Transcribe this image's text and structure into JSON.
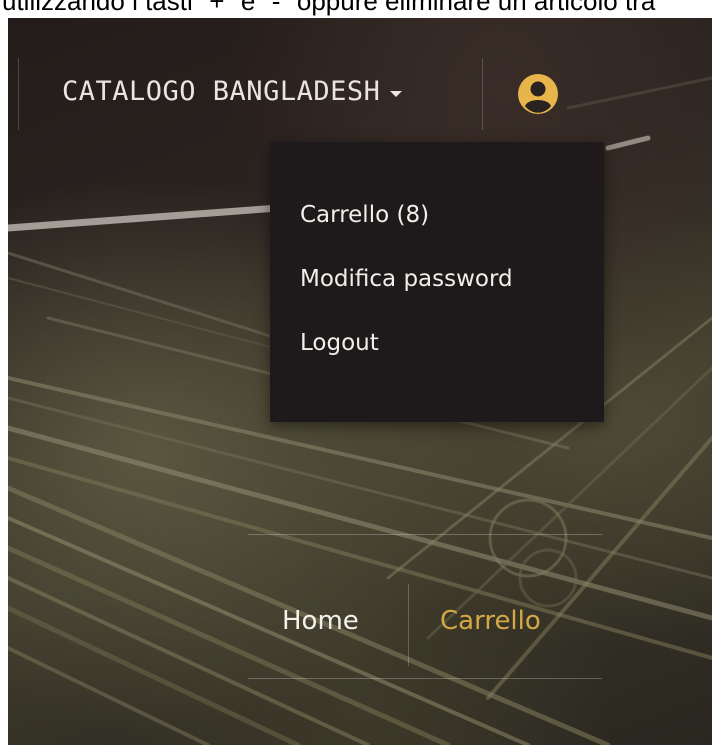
{
  "top_text": "utilizzando i tasti \"+\" e \"-\" oppure eliminare un articolo tra",
  "navbar": {
    "brand": "CATALOGO BANGLADESH",
    "user_icon": "user-circle-icon",
    "accent_color": "#e8b54a"
  },
  "dropdown": {
    "items": [
      {
        "label": "Carrello (8)"
      },
      {
        "label": "Modifica password"
      },
      {
        "label": "Logout"
      }
    ]
  },
  "page_nav": {
    "items": [
      {
        "label": "Home"
      },
      {
        "label": "Carrello"
      }
    ],
    "active_color": "#d6a845"
  }
}
